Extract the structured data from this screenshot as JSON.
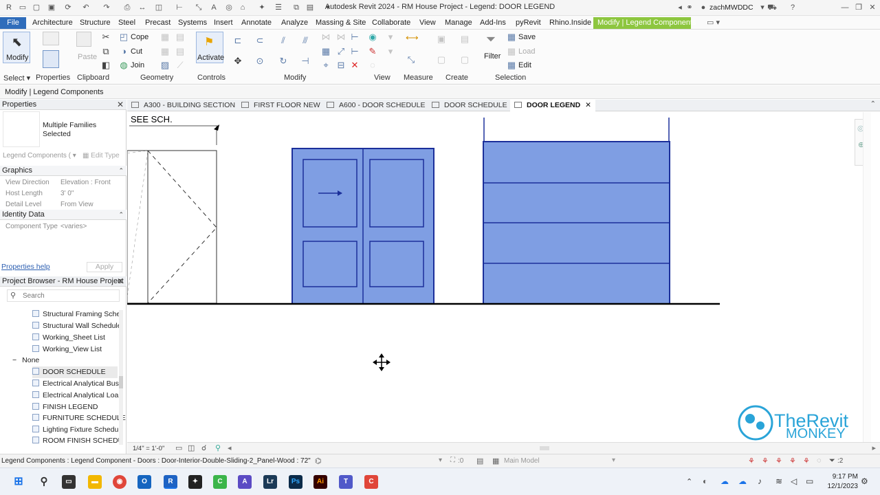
{
  "app": {
    "title": "Autodesk Revit 2024 - RM House Project - Legend: DOOR LEGEND",
    "user": "zachMWDDC"
  },
  "ribbon_tabs": [
    "File",
    "Architecture",
    "Structure",
    "Steel",
    "Precast",
    "Systems",
    "Insert",
    "Annotate",
    "Analyze",
    "Massing & Site",
    "Collaborate",
    "View",
    "Manage",
    "Add-Ins",
    "pyRevit",
    "Rhino.Inside",
    "Modify | Legend Components"
  ],
  "ribbon": {
    "modify_label": "Modify",
    "paste_label": "Paste",
    "cope_label": "Cope",
    "cut_label": "Cut",
    "join_label": "Join",
    "activate_label": "Activate",
    "filter_label": "Filter",
    "save_label": "Save",
    "load_label": "Load",
    "edit_label": "Edit",
    "panels": {
      "select": "Select",
      "properties": "Properties",
      "clipboard": "Clipboard",
      "geometry": "Geometry",
      "controls": "Controls",
      "modify": "Modify",
      "view": "View",
      "measure": "Measure",
      "create": "Create",
      "selection": "Selection"
    }
  },
  "context_bar": "Modify | Legend Components",
  "properties": {
    "header": "Properties",
    "type_name": "Multiple Families Selected",
    "type_selector": "Legend Components (",
    "edit_type": "Edit Type",
    "section_graphics": "Graphics",
    "rows": [
      {
        "k": "View Direction",
        "v": "Elevation : Front"
      },
      {
        "k": "Host Length",
        "v": "3' 0\""
      },
      {
        "k": "Detail Level",
        "v": "From View"
      }
    ],
    "section_identity": "Identity Data",
    "identity_rows": [
      {
        "k": "Component Type",
        "v": "<varies>"
      }
    ],
    "help_link": "Properties help",
    "apply_label": "Apply"
  },
  "project_browser": {
    "header": "Project Browser - RM House Project",
    "search_placeholder": "Search",
    "items_top": [
      "Structural Framing Sche",
      "Structural Wall Schedule",
      "Working_Sheet List",
      "Working_View List"
    ],
    "group": "None",
    "items_bottom": [
      "DOOR SCHEDULE",
      "Electrical Analytical Bus",
      "Electrical Analytical Loa",
      "FINISH LEGEND",
      "FURNITURE SCHEDULE",
      "Lighting Fixture Schedu",
      "ROOM FINISH SCHEDU"
    ]
  },
  "doc_tabs": [
    "A300 - BUILDING SECTION",
    "FIRST FLOOR NEW",
    "A600 - DOOR SCHEDULE",
    "DOOR SCHEDULE",
    "DOOR LEGEND"
  ],
  "canvas": {
    "note_text": "SEE SCH."
  },
  "view_bar": {
    "scale": "1/4\" = 1'-0\""
  },
  "status": {
    "text": "Legend Components : Legend Component - Doors : Door-Interior-Double-Sliding-2_Panel-Wood : 72\"",
    "zero": ":0",
    "workset": "Main Model",
    "filter_count": ":2"
  },
  "watermark": {
    "line1": "TheRevit",
    "line2": "MONKEY"
  },
  "taskbar": {
    "time": "9:17 PM",
    "date": "12/1/2023"
  },
  "colors": {
    "accent_tab": "#8dc63f",
    "file_tab": "#2f6dbb",
    "door_fill": "#7f9ee3",
    "door_stroke": "#1b2f9a"
  }
}
